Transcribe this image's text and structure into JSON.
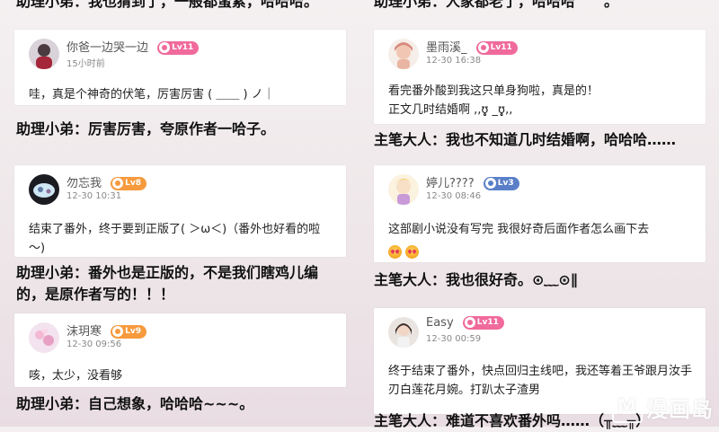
{
  "left_column": {
    "top_reply": "助理小弟：我也猜到了，一般都蛮累，哈哈哈。",
    "comments": [
      {
        "username": "你爸一边哭一边",
        "level": "Lv11",
        "time": "15小时前",
        "content": "哇，真是个神奇的伏笔，厉害厉害 ( ＿＿ ) ノ｜",
        "reply": "助理小弟：厉害厉害，夸原作者一哈子。"
      },
      {
        "username": "勿忘我",
        "level": "Lv8",
        "time": "12-30 10:31",
        "content": "结束了番外，终于要到正版了( ＞ω＜)（番外也好看的啦～)",
        "reply": "助理小弟：番外也是正版的，不是我们瞎鸡儿编的，是原作者写的！！！"
      },
      {
        "username": "沫玥寒",
        "level": "Lv9",
        "time": "12-30 09:56",
        "content": "咳，太少，没看够",
        "reply": "助理小弟：自己想象，哈哈哈~~~。"
      }
    ]
  },
  "right_column": {
    "top_reply": "助理小弟：人家都老了，哈哈哈　　。",
    "comments": [
      {
        "username": "墨雨溪_",
        "level": "Lv11",
        "time": "12-30 16:38",
        "content": "看完番外酸到我这只单身狗啦，真是的！\n正文几时结婚啊 ,,ʊ̥̥̥̥̥ _ʊ̥̥̥̥̥,,",
        "reply": "主笔大人：我也不知道几时结婚啊，哈哈哈……"
      },
      {
        "username": "婷儿????",
        "level": "Lv3",
        "time": "12-30 08:46",
        "content": "这部剧小说没有写完 我很好奇后面作者怎么画下去",
        "reply": "主笔大人：我也很好奇。⊙﹏⊙∥"
      },
      {
        "username": "Easy",
        "level": "Lv11",
        "time": "12-30 00:59",
        "content": "终于结束了番外，快点回归主线吧，我还等着王爷跟月汝手刃白莲花月婉。打趴太子渣男",
        "reply": "主笔大人：难道不喜欢番外吗……（╥﹏╥）"
      }
    ]
  },
  "watermark": {
    "badge": "M",
    "text": "漫画岛"
  }
}
